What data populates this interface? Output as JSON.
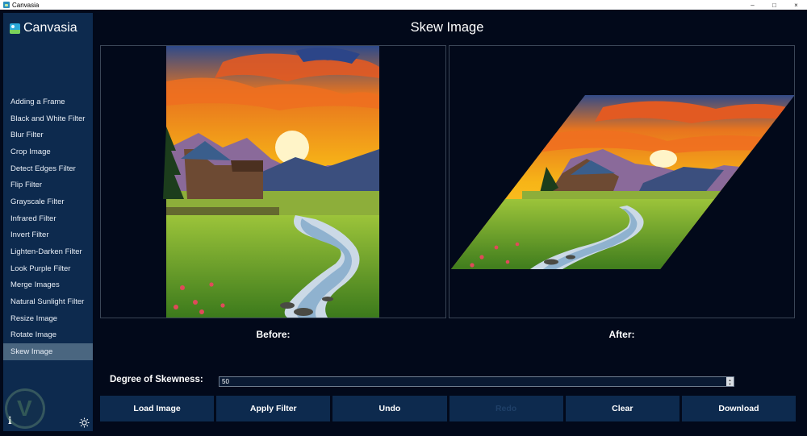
{
  "window": {
    "title": "Canvasia",
    "controls": [
      "–",
      "□",
      "×"
    ]
  },
  "app": {
    "name": "Canvasia",
    "logo_icon": "image-icon"
  },
  "sidebar": {
    "items": [
      {
        "label": "Adding a Frame"
      },
      {
        "label": "Black and White Filter"
      },
      {
        "label": "Blur Filter"
      },
      {
        "label": "Crop Image"
      },
      {
        "label": "Detect Edges Filter"
      },
      {
        "label": "Flip Filter"
      },
      {
        "label": "Grayscale Filter"
      },
      {
        "label": "Infrared Filter"
      },
      {
        "label": "Invert Filter"
      },
      {
        "label": "Lighten-Darken Filter"
      },
      {
        "label": "Look Purple Filter"
      },
      {
        "label": "Merge Images"
      },
      {
        "label": "Natural Sunlight Filter"
      },
      {
        "label": "Resize Image"
      },
      {
        "label": "Rotate Image"
      },
      {
        "label": "Skew Image",
        "active": true
      }
    ],
    "info_icon": "i",
    "theme_icon": "sun-icon"
  },
  "main": {
    "title": "Skew Image",
    "before_caption": "Before:",
    "after_caption": "After:",
    "skew": {
      "label": "Degree of Skewness:",
      "value": "50"
    },
    "buttons": {
      "load": "Load Image",
      "apply": "Apply Filter",
      "undo": "Undo",
      "redo": "Redo",
      "clear": "Clear",
      "download": "Download"
    }
  },
  "colors": {
    "background": "#02091a",
    "sidebar": "#0d2a4e",
    "active_item": "#4a6680",
    "button": "#0d2a4e"
  }
}
